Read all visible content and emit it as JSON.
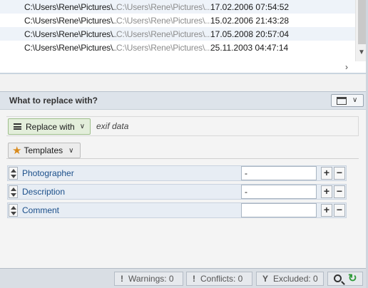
{
  "file_list": {
    "rows": [
      {
        "original": "C:\\Users\\Rene\\Pictures\\...",
        "new": "C:\\Users\\Rene\\Pictures\\...",
        "date": "17.02.2006 07:54:52"
      },
      {
        "original": "C:\\Users\\Rene\\Pictures\\...",
        "new": "C:\\Users\\Rene\\Pictures\\...",
        "date": "15.02.2006 21:43:28"
      },
      {
        "original": "C:\\Users\\Rene\\Pictures\\...",
        "new": "C:\\Users\\Rene\\Pictures\\...",
        "date": "17.05.2008 20:57:04"
      },
      {
        "original": "C:\\Users\\Rene\\Pictures\\...",
        "new": "C:\\Users\\Rene\\Pictures\\...",
        "date": "25.11.2003 04:47:14"
      }
    ],
    "scroll_right_icon": "›",
    "scroll_down_icon": "▼"
  },
  "section": {
    "title": "What to replace with?",
    "view_chevron": "∨"
  },
  "replace": {
    "button_label": "Replace with",
    "chevron": "∨",
    "value": "exif data"
  },
  "templates": {
    "button_label": "Templates",
    "star_icon": "★",
    "chevron": "∨"
  },
  "fields": [
    {
      "label": "Photographer",
      "value": "-"
    },
    {
      "label": "Description",
      "value": "-"
    },
    {
      "label": "Comment",
      "value": ""
    }
  ],
  "field_buttons": {
    "plus": "+",
    "minus": "−"
  },
  "status": {
    "warnings": "Warnings: 0",
    "conflicts": "Conflicts: 0",
    "excluded": "Excluded: 0",
    "warn_icon": "!",
    "conflict_icon": "!",
    "filter_icon": "Y",
    "refresh_icon": "↻"
  }
}
